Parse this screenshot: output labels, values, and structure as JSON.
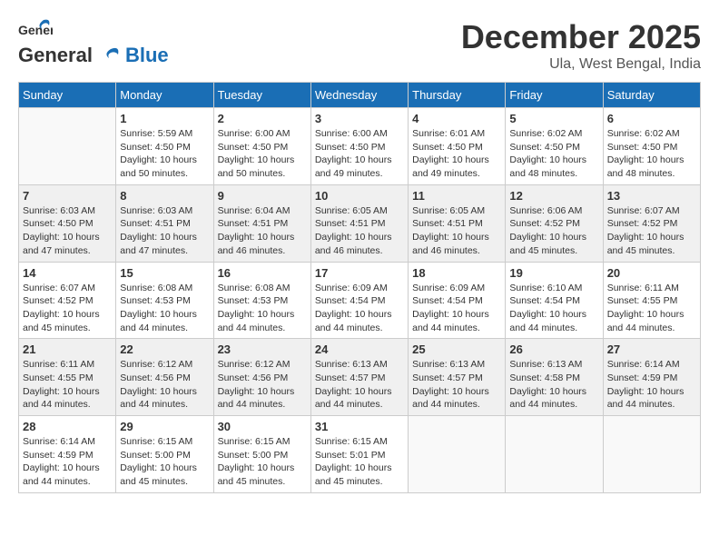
{
  "header": {
    "logo_general": "General",
    "logo_blue": "Blue",
    "month": "December 2025",
    "location": "Ula, West Bengal, India"
  },
  "days_of_week": [
    "Sunday",
    "Monday",
    "Tuesday",
    "Wednesday",
    "Thursday",
    "Friday",
    "Saturday"
  ],
  "weeks": [
    {
      "shaded": false,
      "days": [
        {
          "num": "",
          "empty": true
        },
        {
          "num": "1",
          "sunrise": "Sunrise: 5:59 AM",
          "sunset": "Sunset: 4:50 PM",
          "daylight": "Daylight: 10 hours and 50 minutes."
        },
        {
          "num": "2",
          "sunrise": "Sunrise: 6:00 AM",
          "sunset": "Sunset: 4:50 PM",
          "daylight": "Daylight: 10 hours and 50 minutes."
        },
        {
          "num": "3",
          "sunrise": "Sunrise: 6:00 AM",
          "sunset": "Sunset: 4:50 PM",
          "daylight": "Daylight: 10 hours and 49 minutes."
        },
        {
          "num": "4",
          "sunrise": "Sunrise: 6:01 AM",
          "sunset": "Sunset: 4:50 PM",
          "daylight": "Daylight: 10 hours and 49 minutes."
        },
        {
          "num": "5",
          "sunrise": "Sunrise: 6:02 AM",
          "sunset": "Sunset: 4:50 PM",
          "daylight": "Daylight: 10 hours and 48 minutes."
        },
        {
          "num": "6",
          "sunrise": "Sunrise: 6:02 AM",
          "sunset": "Sunset: 4:50 PM",
          "daylight": "Daylight: 10 hours and 48 minutes."
        }
      ]
    },
    {
      "shaded": true,
      "days": [
        {
          "num": "7",
          "sunrise": "Sunrise: 6:03 AM",
          "sunset": "Sunset: 4:50 PM",
          "daylight": "Daylight: 10 hours and 47 minutes."
        },
        {
          "num": "8",
          "sunrise": "Sunrise: 6:03 AM",
          "sunset": "Sunset: 4:51 PM",
          "daylight": "Daylight: 10 hours and 47 minutes."
        },
        {
          "num": "9",
          "sunrise": "Sunrise: 6:04 AM",
          "sunset": "Sunset: 4:51 PM",
          "daylight": "Daylight: 10 hours and 46 minutes."
        },
        {
          "num": "10",
          "sunrise": "Sunrise: 6:05 AM",
          "sunset": "Sunset: 4:51 PM",
          "daylight": "Daylight: 10 hours and 46 minutes."
        },
        {
          "num": "11",
          "sunrise": "Sunrise: 6:05 AM",
          "sunset": "Sunset: 4:51 PM",
          "daylight": "Daylight: 10 hours and 46 minutes."
        },
        {
          "num": "12",
          "sunrise": "Sunrise: 6:06 AM",
          "sunset": "Sunset: 4:52 PM",
          "daylight": "Daylight: 10 hours and 45 minutes."
        },
        {
          "num": "13",
          "sunrise": "Sunrise: 6:07 AM",
          "sunset": "Sunset: 4:52 PM",
          "daylight": "Daylight: 10 hours and 45 minutes."
        }
      ]
    },
    {
      "shaded": false,
      "days": [
        {
          "num": "14",
          "sunrise": "Sunrise: 6:07 AM",
          "sunset": "Sunset: 4:52 PM",
          "daylight": "Daylight: 10 hours and 45 minutes."
        },
        {
          "num": "15",
          "sunrise": "Sunrise: 6:08 AM",
          "sunset": "Sunset: 4:53 PM",
          "daylight": "Daylight: 10 hours and 44 minutes."
        },
        {
          "num": "16",
          "sunrise": "Sunrise: 6:08 AM",
          "sunset": "Sunset: 4:53 PM",
          "daylight": "Daylight: 10 hours and 44 minutes."
        },
        {
          "num": "17",
          "sunrise": "Sunrise: 6:09 AM",
          "sunset": "Sunset: 4:54 PM",
          "daylight": "Daylight: 10 hours and 44 minutes."
        },
        {
          "num": "18",
          "sunrise": "Sunrise: 6:09 AM",
          "sunset": "Sunset: 4:54 PM",
          "daylight": "Daylight: 10 hours and 44 minutes."
        },
        {
          "num": "19",
          "sunrise": "Sunrise: 6:10 AM",
          "sunset": "Sunset: 4:54 PM",
          "daylight": "Daylight: 10 hours and 44 minutes."
        },
        {
          "num": "20",
          "sunrise": "Sunrise: 6:11 AM",
          "sunset": "Sunset: 4:55 PM",
          "daylight": "Daylight: 10 hours and 44 minutes."
        }
      ]
    },
    {
      "shaded": true,
      "days": [
        {
          "num": "21",
          "sunrise": "Sunrise: 6:11 AM",
          "sunset": "Sunset: 4:55 PM",
          "daylight": "Daylight: 10 hours and 44 minutes."
        },
        {
          "num": "22",
          "sunrise": "Sunrise: 6:12 AM",
          "sunset": "Sunset: 4:56 PM",
          "daylight": "Daylight: 10 hours and 44 minutes."
        },
        {
          "num": "23",
          "sunrise": "Sunrise: 6:12 AM",
          "sunset": "Sunset: 4:56 PM",
          "daylight": "Daylight: 10 hours and 44 minutes."
        },
        {
          "num": "24",
          "sunrise": "Sunrise: 6:13 AM",
          "sunset": "Sunset: 4:57 PM",
          "daylight": "Daylight: 10 hours and 44 minutes."
        },
        {
          "num": "25",
          "sunrise": "Sunrise: 6:13 AM",
          "sunset": "Sunset: 4:57 PM",
          "daylight": "Daylight: 10 hours and 44 minutes."
        },
        {
          "num": "26",
          "sunrise": "Sunrise: 6:13 AM",
          "sunset": "Sunset: 4:58 PM",
          "daylight": "Daylight: 10 hours and 44 minutes."
        },
        {
          "num": "27",
          "sunrise": "Sunrise: 6:14 AM",
          "sunset": "Sunset: 4:59 PM",
          "daylight": "Daylight: 10 hours and 44 minutes."
        }
      ]
    },
    {
      "shaded": false,
      "days": [
        {
          "num": "28",
          "sunrise": "Sunrise: 6:14 AM",
          "sunset": "Sunset: 4:59 PM",
          "daylight": "Daylight: 10 hours and 44 minutes."
        },
        {
          "num": "29",
          "sunrise": "Sunrise: 6:15 AM",
          "sunset": "Sunset: 5:00 PM",
          "daylight": "Daylight: 10 hours and 45 minutes."
        },
        {
          "num": "30",
          "sunrise": "Sunrise: 6:15 AM",
          "sunset": "Sunset: 5:00 PM",
          "daylight": "Daylight: 10 hours and 45 minutes."
        },
        {
          "num": "31",
          "sunrise": "Sunrise: 6:15 AM",
          "sunset": "Sunset: 5:01 PM",
          "daylight": "Daylight: 10 hours and 45 minutes."
        },
        {
          "num": "",
          "empty": true
        },
        {
          "num": "",
          "empty": true
        },
        {
          "num": "",
          "empty": true
        }
      ]
    }
  ]
}
